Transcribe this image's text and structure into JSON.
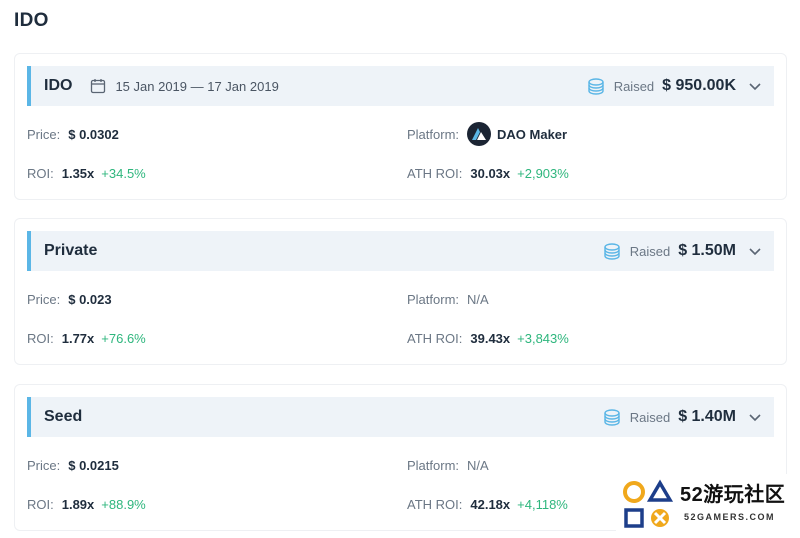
{
  "page": {
    "title": "IDO"
  },
  "rounds": [
    {
      "name": "IDO",
      "date_range": "15 Jan 2019 — 17 Jan 2019",
      "raised_label": "Raised",
      "raised_value": "$ 950.00K",
      "price_label": "Price:",
      "price_value": "$ 0.0302",
      "platform_label": "Platform:",
      "platform_value": "DAO Maker",
      "roi_label": "ROI:",
      "roi_value": "1.35x",
      "roi_pct": "+34.5%",
      "ath_label": "ATH ROI:",
      "ath_value": "30.03x",
      "ath_pct": "+2,903%"
    },
    {
      "name": "Private",
      "raised_label": "Raised",
      "raised_value": "$ 1.50M",
      "price_label": "Price:",
      "price_value": "$ 0.023",
      "platform_label": "Platform:",
      "platform_value": "N/A",
      "roi_label": "ROI:",
      "roi_value": "1.77x",
      "roi_pct": "+76.6%",
      "ath_label": "ATH ROI:",
      "ath_value": "39.43x",
      "ath_pct": "+3,843%"
    },
    {
      "name": "Seed",
      "raised_label": "Raised",
      "raised_value": "$ 1.40M",
      "price_label": "Price:",
      "price_value": "$ 0.0215",
      "platform_label": "Platform:",
      "platform_value": "N/A",
      "roi_label": "ROI:",
      "roi_value": "1.89x",
      "roi_pct": "+88.9%",
      "ath_label": "ATH ROI:",
      "ath_value": "42.18x",
      "ath_pct": "+4,118%"
    }
  ],
  "watermark": {
    "text": "52游玩社区",
    "sub": "52GAMERS.COM"
  },
  "icons": {
    "date": "calendar-icon",
    "raised": "coins-icon",
    "expand": "chevron-down-icon"
  },
  "colors": {
    "accent": "#5bb6e6",
    "positive": "#2eb67d",
    "header_bg": "#eef3f8"
  }
}
